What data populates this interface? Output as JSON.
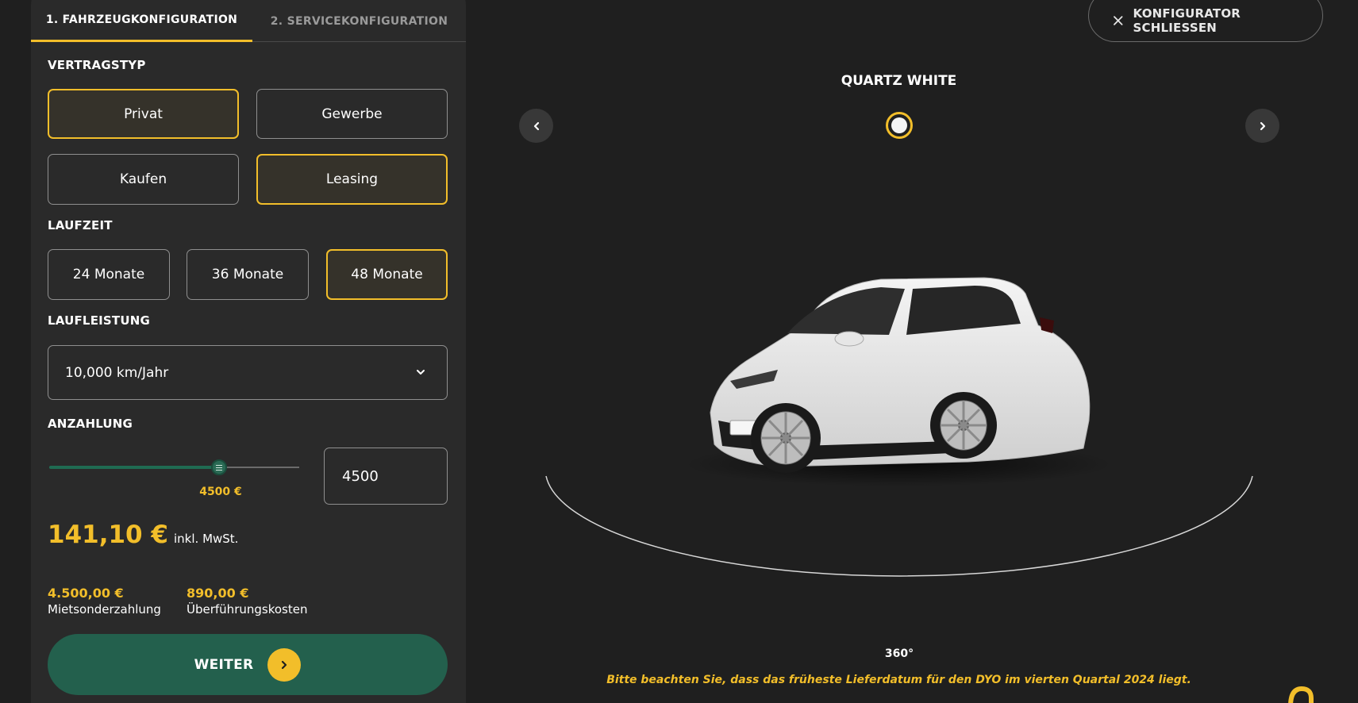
{
  "tabs": [
    {
      "label": "1. FAHRZEUGKONFIGURATION",
      "active": true
    },
    {
      "label": "2. SERVICEKONFIGURATION",
      "active": false
    }
  ],
  "vertragstyp": {
    "label": "VERTRAGSTYP",
    "customer_options": [
      "Privat",
      "Gewerbe"
    ],
    "customer_selected": "Privat",
    "purchase_options": [
      "Kaufen",
      "Leasing"
    ],
    "purchase_selected": "Leasing"
  },
  "laufzeit": {
    "label": "LAUFZEIT",
    "options": [
      "24 Monate",
      "36 Monate",
      "48 Monate"
    ],
    "selected": "48 Monate"
  },
  "laufleistung": {
    "label": "LAUFLEISTUNG",
    "value": "10,000 km/Jahr"
  },
  "anzahlung": {
    "label": "ANZAHLUNG",
    "slider_fraction": 0.68,
    "slider_value_label": "4500 €",
    "input_value": "4500"
  },
  "price": {
    "amount": "141,10 €",
    "tax_note": "inkl. MwSt."
  },
  "fees": [
    {
      "value": "4.500,00 €",
      "label": "Mietsonderzahlung"
    },
    {
      "value": "890,00 €",
      "label": "Überführungskosten"
    }
  ],
  "next_button": {
    "label": "WEITER"
  },
  "close_button": {
    "label": "KONFIGURATOR SCHLIESSEN"
  },
  "color": {
    "name": "QUARTZ WHITE",
    "swatch_hex": "#f3f3f3"
  },
  "view_label": "360°",
  "notice": "Bitte beachten Sie, dass das früheste Lieferdatum für den DYO im vierten Quartal 2024 liegt.",
  "colors": {
    "accent": "#f2be2a",
    "cta": "#23604d",
    "panel": "#2a2a2a",
    "background": "#1f1f1f"
  }
}
